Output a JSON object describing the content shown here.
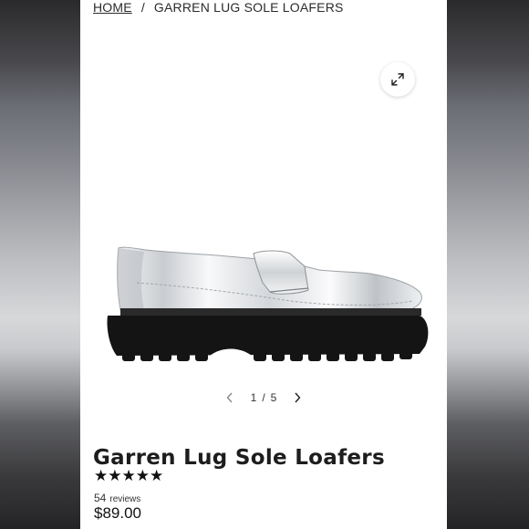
{
  "breadcrumb": {
    "home": "HOME",
    "separator": "/",
    "current": "GARREN LUG SOLE LOAFERS"
  },
  "gallery": {
    "expand_icon": "expand-arrows-icon",
    "current_page": "1",
    "separator": "/",
    "total_pages": "5",
    "prev_icon": "chevron-left-icon",
    "next_icon": "chevron-right-icon"
  },
  "product": {
    "title": "Garren Lug Sole Loafers",
    "rating": 5,
    "rating_stars": "★★★★★",
    "review_count": "54",
    "review_label": "reviews",
    "price": "$89.00"
  },
  "colors": {
    "page_bg": "#ffffff",
    "text": "#1d1d1d",
    "sole": "#141414",
    "upper": "#e4e6e8"
  }
}
